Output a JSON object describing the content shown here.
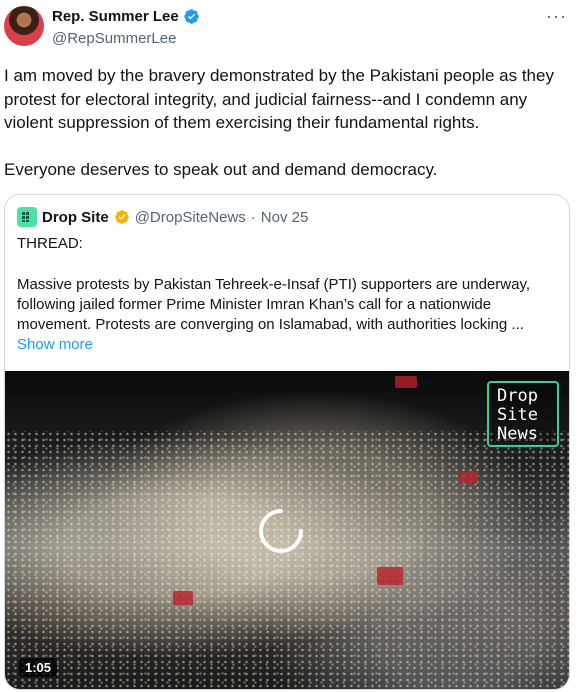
{
  "tweet": {
    "author_name": "Rep. Summer Lee",
    "author_handle": "@RepSummerLee",
    "text": "I am moved by the bravery demonstrated by the Pakistani people as they protest for electoral integrity, and judicial fairness--and I condemn any violent suppression of them exercising their fundamental rights.\n\nEveryone deserves to speak out and demand democracy.",
    "more_icon": "more-horizontal-icon",
    "verified_color": "#1d9bf0"
  },
  "quote": {
    "author_name": "Drop Site",
    "author_handle": "@DropSiteNews",
    "separator": "·",
    "date": "Nov 25",
    "thread_label": "THREAD:",
    "body": "Massive protests by Pakistan Tehreek-e-Insaf (PTI) supporters are underway, following jailed former Prime Minister Imran Khan’s call for a nationwide movement. Protests are converging on Islamabad, with authorities locking ...",
    "show_more": "Show more",
    "verified_color": "#f4b400",
    "video": {
      "watermark_line1": "Drop",
      "watermark_line2": "Site",
      "watermark_line3": "News",
      "duration": "1:05"
    }
  }
}
